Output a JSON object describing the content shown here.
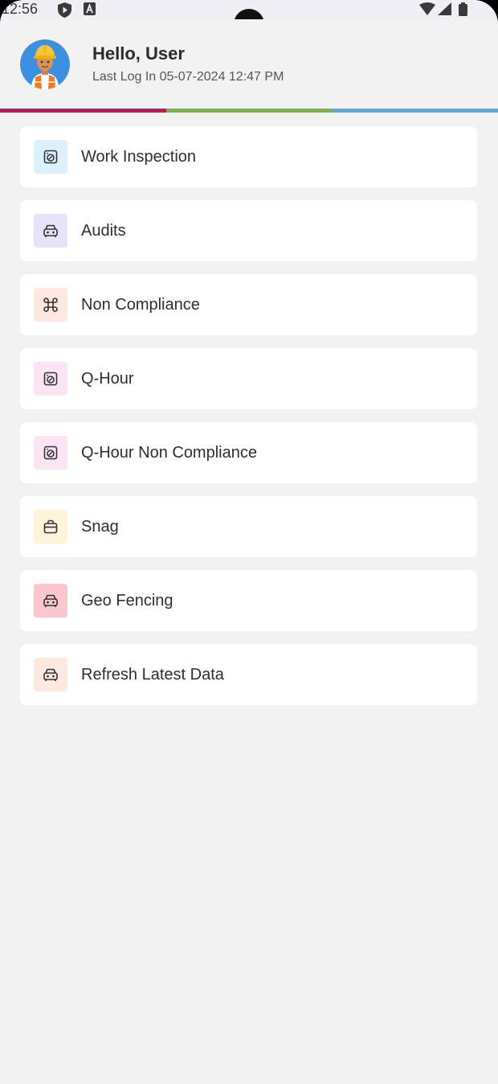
{
  "status_bar": {
    "time": "12:56",
    "icons": [
      "shield-play-icon",
      "letter-a-icon",
      "wifi-icon",
      "cellular-signal-icon",
      "battery-icon"
    ]
  },
  "header": {
    "greeting": "Hello, User",
    "last_login": "Last Log In 05-07-2024 12:47 PM",
    "avatar_icon": "construction-worker-avatar-icon"
  },
  "divider_colors": [
    "#c2185b",
    "#7cb342",
    "#5aa9de"
  ],
  "menu": {
    "items": [
      {
        "label": "Work Inspection",
        "icon": "washing-machine-icon",
        "icon_bg": "#dcf1fc"
      },
      {
        "label": "Audits",
        "icon": "vehicle-front-icon",
        "icon_bg": "#e6e4fb"
      },
      {
        "label": "Non Compliance",
        "icon": "command-key-icon",
        "icon_bg": "#fde9df"
      },
      {
        "label": "Q-Hour",
        "icon": "washing-machine-icon",
        "icon_bg": "#fbe5f5"
      },
      {
        "label": "Q-Hour Non Compliance",
        "icon": "washing-machine-icon",
        "icon_bg": "#fbe5f5"
      },
      {
        "label": "Snag",
        "icon": "bag-icon",
        "icon_bg": "#fdf4dc"
      },
      {
        "label": "Geo Fencing",
        "icon": "vehicle-front-icon",
        "icon_bg": "#fcc6cf"
      },
      {
        "label": "Refresh Latest Data",
        "icon": "vehicle-front-icon",
        "icon_bg": "#fde9df"
      }
    ]
  }
}
